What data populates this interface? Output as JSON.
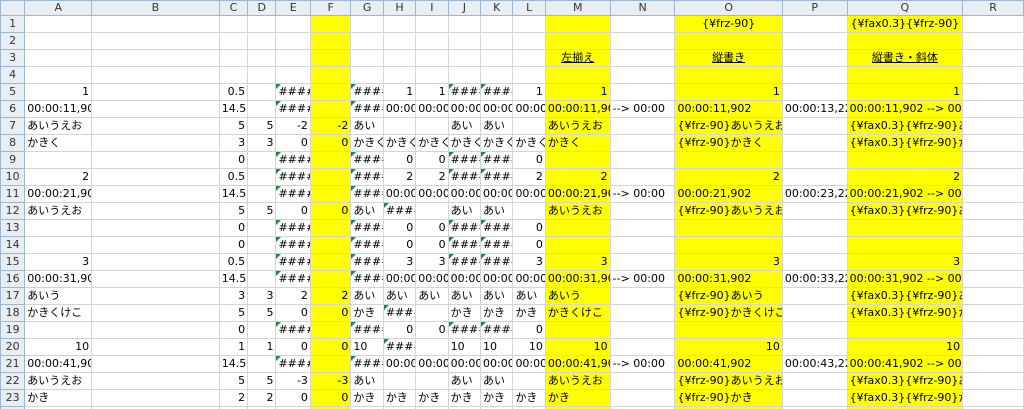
{
  "columns": [
    "A",
    "B",
    "C",
    "D",
    "E",
    "F",
    "G",
    "H",
    "I",
    "J",
    "K",
    "L",
    "M",
    "N",
    "O",
    "P",
    "Q",
    "R"
  ],
  "rows": {
    "r1": {
      "o": "{¥frz-90}",
      "q": "{¥fax0.3}{¥frz-90}"
    },
    "r3": {
      "m": "左揃え",
      "o": "縦書き",
      "q": "縦書き・斜体"
    },
    "r5": {
      "a": "1",
      "c": "0.5",
      "e": "####",
      "g": "####",
      "h": "1",
      "i": "1",
      "j": "####",
      "k": "####",
      "l": "1",
      "m": "1",
      "o": "1",
      "q": "1"
    },
    "r6": {
      "a": "00:00:11,902 --> 00:00:13,229",
      "c": "14.5",
      "e": "####",
      "g": "####",
      "h": "00:00",
      "i": "00:00",
      "j": "00:00",
      "k": "00:00",
      "l": "00:00",
      "m": "00:00:11,902",
      "n": "--> 00:00",
      "o": "00:00:11,902",
      "p": "00:00:13,229",
      "q": "00:00:11,902 --> 00:00:13,229"
    },
    "r7": {
      "a": "あいうえお",
      "c": "5",
      "d": "5",
      "e": "-2",
      "f": "-2",
      "g": "あい",
      "j": "あい",
      "k": "あい",
      "m": "あいうえお",
      "o": "{¥frz-90}あいうえお",
      "q": "{¥fax0.3}{¥frz-90}あいうえお"
    },
    "r8": {
      "a": "かきく",
      "c": "3",
      "d": "3",
      "e": "0",
      "f": "0",
      "g": "かきく",
      "h": "かきく",
      "i": "かきく",
      "j": "かきく",
      "k": "かきく",
      "l": "かきく",
      "m": "かきく",
      "o": "{¥frz-90}かきく",
      "q": "{¥fax0.3}{¥frz-90}かきく"
    },
    "r9": {
      "c": "0",
      "e": "####",
      "g": "####",
      "h": "0",
      "i": "0",
      "j": "####",
      "k": "####",
      "l": "0"
    },
    "r10": {
      "a": "2",
      "c": "0.5",
      "e": "####",
      "g": "####",
      "h": "2",
      "i": "2",
      "j": "####",
      "k": "####",
      "l": "2",
      "m": "2",
      "o": "2",
      "q": "2"
    },
    "r11": {
      "a": "00:00:21,902 --> 00:00:23,229",
      "c": "14.5",
      "e": "####",
      "g": "####",
      "h": "00:00",
      "i": "00:00",
      "j": "00:00",
      "k": "00:00",
      "l": "00:00",
      "m": "00:00:21,902",
      "n": "--> 00:00",
      "o": "00:00:21,902",
      "p": "00:00:23,229",
      "q": "00:00:21,902 --> 00:00:23,229"
    },
    "r12": {
      "a": "あいうえお",
      "c": "5",
      "d": "5",
      "e": "0",
      "f": "0",
      "g": "あい",
      "h": "####",
      "j": "あい",
      "k": "あい",
      "m": "あいうえお",
      "o": "{¥frz-90}あいうえお",
      "q": "{¥fax0.3}{¥frz-90}あいうえお"
    },
    "r13": {
      "c": "0",
      "e": "####",
      "g": "####",
      "h": "0",
      "i": "0",
      "j": "####",
      "k": "####",
      "l": "0"
    },
    "r14": {
      "c": "0",
      "e": "####",
      "g": "####",
      "h": "0",
      "i": "0",
      "j": "####",
      "k": "####",
      "l": "0"
    },
    "r15": {
      "a": "3",
      "c": "0.5",
      "e": "####",
      "g": "####",
      "h": "3",
      "i": "3",
      "j": "####",
      "k": "####",
      "l": "3",
      "m": "3",
      "o": "3",
      "q": "3"
    },
    "r16": {
      "a": "00:00:31,902 --> 00:00:33,229",
      "c": "14.5",
      "e": "####",
      "g": "####",
      "h": "00:00",
      "i": "00:00",
      "j": "00:00",
      "k": "00:00",
      "l": "00:00",
      "m": "00:00:31,902",
      "n": "--> 00:00",
      "o": "00:00:31,902",
      "p": "00:00:33,229",
      "q": "00:00:31,902 --> 00:00:33,229"
    },
    "r17": {
      "a": "あいう",
      "c": "3",
      "d": "3",
      "e": "2",
      "f": "2",
      "g": "あい",
      "h": "あい",
      "i": "あい",
      "j": "あい",
      "k": "あい",
      "l": "あい",
      "m": "あいう",
      "o": "{¥frz-90}あいう",
      "q": "{¥fax0.3}{¥frz-90}あいう"
    },
    "r18": {
      "a": "かきくけこ",
      "c": "5",
      "d": "5",
      "e": "0",
      "f": "0",
      "g": "かき",
      "h": "####",
      "j": "かき",
      "k": "かき",
      "l": "かき",
      "m": "かきくけこ",
      "o": "{¥frz-90}かきくけこ",
      "q": "{¥fax0.3}{¥frz-90}かきくけこ"
    },
    "r19": {
      "c": "0",
      "e": "####",
      "g": "####",
      "h": "0",
      "i": "0",
      "j": "####",
      "k": "####",
      "l": "0"
    },
    "r20": {
      "a": "10",
      "c": "1",
      "d": "1",
      "e": "0",
      "f": "0",
      "g": "10",
      "h": "####",
      "j": "10",
      "k": "10",
      "l": "10",
      "m": "10",
      "o": "10",
      "q": "10"
    },
    "r21": {
      "a": "00:00:41,902 --> 00:00:43,229",
      "c": "14.5",
      "e": "####",
      "g": "####",
      "h": "00:00",
      "i": "00:00",
      "j": "00:00",
      "k": "00:00",
      "l": "00:00",
      "m": "00:00:41,902",
      "n": "--> 00:00",
      "o": "00:00:41,902",
      "p": "00:00:43,229",
      "q": "00:00:41,902 --> 00:00:43,229"
    },
    "r22": {
      "a": "あいうえお",
      "c": "5",
      "d": "5",
      "e": "-3",
      "f": "-3",
      "g": "あい",
      "j": "あい",
      "k": "あい",
      "m": "あいうえお",
      "o": "{¥frz-90}あいうえお",
      "q": "{¥fax0.3}{¥frz-90}あいうえお"
    },
    "r23": {
      "a": "かき",
      "c": "2",
      "d": "2",
      "e": "0",
      "f": "0",
      "g": "かき",
      "h": "かき",
      "i": "かき",
      "j": "かき",
      "k": "かき",
      "l": "かき",
      "m": "かき",
      "o": "{¥frz-90}かき",
      "q": "{¥fax0.3}{¥frz-90}かき"
    }
  },
  "colors": {
    "highlight": "#ffff00",
    "header_bg": "#e9eef5",
    "grid": "#d4d4d4",
    "error_marker": "#1e8a3a"
  }
}
